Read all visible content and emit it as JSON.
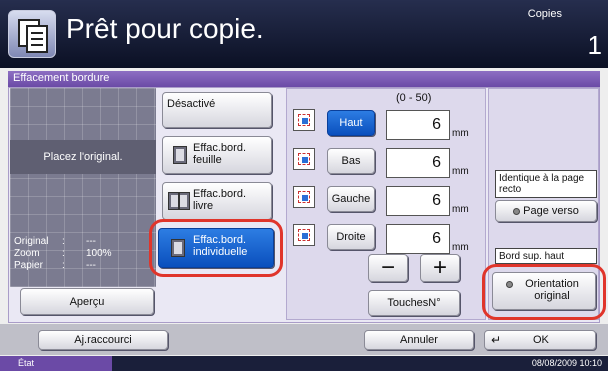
{
  "header": {
    "title": "Prêt pour copie.",
    "copies_label": "Copies",
    "copies_count": "1",
    "icon": "copier-icon"
  },
  "panel_title": "Effacement bordure",
  "preview": {
    "message": "Placez l'original.",
    "info": [
      {
        "key": "Original",
        "value": "---"
      },
      {
        "key": "Zoom",
        "value": "100%"
      },
      {
        "key": "Papier",
        "value": "---"
      }
    ],
    "button": "Aperçu"
  },
  "modes": {
    "off": "Désactivé",
    "sheet": "Effac.bord. feuille",
    "book": "Effac.bord. livre",
    "individual": "Effac.bord. individuelle",
    "selected": "individual"
  },
  "sides": {
    "range": "(0 - 50)",
    "unit": "mm",
    "items": [
      {
        "label": "Haut",
        "value": "6",
        "selected": true
      },
      {
        "label": "Bas",
        "value": "6",
        "selected": false
      },
      {
        "label": "Gauche",
        "value": "6",
        "selected": false
      },
      {
        "label": "Droite",
        "value": "6",
        "selected": false
      }
    ],
    "minus": "−",
    "plus": "+",
    "keys_button": "TouchesN°"
  },
  "back_page": {
    "label": "Identique à la page recto",
    "button": "Page verso"
  },
  "orientation": {
    "label": "Bord sup. haut",
    "button": "Orientation original"
  },
  "bottom": {
    "shortcut": "Aj.raccourci",
    "cancel": "Annuler",
    "ok": "OK"
  },
  "status": {
    "state": "État",
    "datetime": "08/08/2009   10:10"
  },
  "colors": {
    "accent": "#6b4aa6",
    "selected": "#1760d0",
    "highlight": "#e0352b"
  }
}
